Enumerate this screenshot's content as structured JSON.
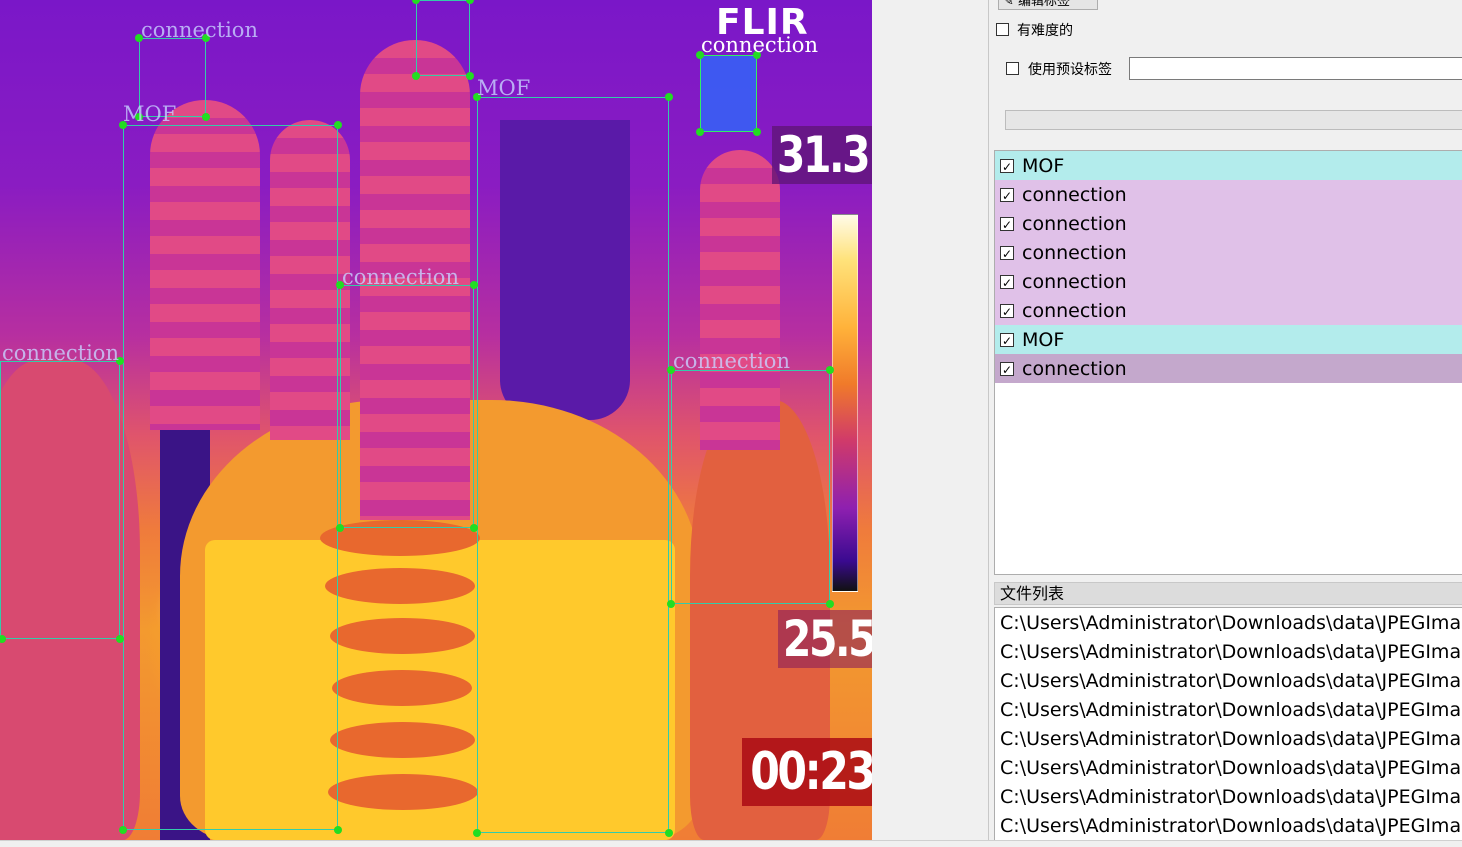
{
  "canvas": {
    "brand": "FLIR",
    "temp_max": "31.3",
    "temp_min": "25.5",
    "timestamp": "00:23",
    "box_labels": [
      "connection",
      "MOF",
      "MOF",
      "connection",
      "connection",
      "connection",
      "connection"
    ]
  },
  "panel": {
    "edit_label_button": "编辑标签",
    "difficult_label": "有难度的",
    "use_preset_label": "使用预设标签",
    "preset_value": "",
    "labels": [
      {
        "text": "MOF",
        "checked": true,
        "color": "#b3ecec"
      },
      {
        "text": "connection",
        "checked": true,
        "color": "#e0c1e8"
      },
      {
        "text": "connection",
        "checked": true,
        "color": "#e0c1e8"
      },
      {
        "text": "connection",
        "checked": true,
        "color": "#e0c1e8"
      },
      {
        "text": "connection",
        "checked": true,
        "color": "#e0c1e8"
      },
      {
        "text": "connection",
        "checked": true,
        "color": "#e0c1e8"
      },
      {
        "text": "MOF",
        "checked": true,
        "color": "#b3ecec"
      },
      {
        "text": "connection",
        "checked": true,
        "color": "#c4a8cc"
      }
    ],
    "file_list_title": "文件列表",
    "files": [
      "C:\\Users\\Administrator\\Downloads\\data\\JPEGIma",
      "C:\\Users\\Administrator\\Downloads\\data\\JPEGIma",
      "C:\\Users\\Administrator\\Downloads\\data\\JPEGIma",
      "C:\\Users\\Administrator\\Downloads\\data\\JPEGIma",
      "C:\\Users\\Administrator\\Downloads\\data\\JPEGIma",
      "C:\\Users\\Administrator\\Downloads\\data\\JPEGIma",
      "C:\\Users\\Administrator\\Downloads\\data\\JPEGIma",
      "C:\\Users\\Administrator\\Downloads\\data\\JPEGIma"
    ]
  }
}
